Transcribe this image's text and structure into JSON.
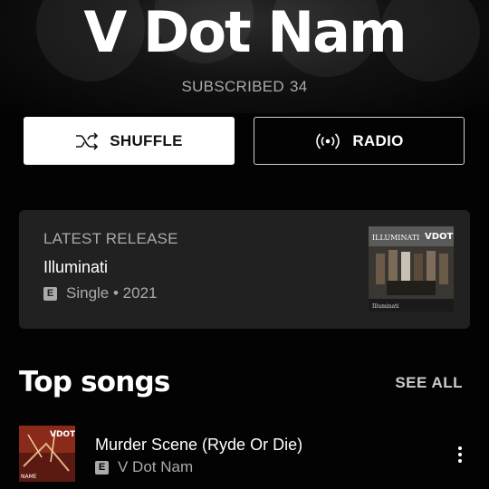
{
  "artist": {
    "name": "V Dot Nam",
    "subscribed_label": "SUBSCRIBED",
    "subscriber_count": "34"
  },
  "actions": {
    "shuffle_label": "SHUFFLE",
    "radio_label": "RADIO"
  },
  "latest_release": {
    "kicker": "LATEST RELEASE",
    "title": "Illuminati",
    "explicit_badge": "E",
    "meta": "Single • 2021",
    "art_text_left": "ILLUMINATI",
    "art_text_right": "VDOT",
    "art_text_bottom": "Illuminati"
  },
  "top_songs": {
    "heading": "Top songs",
    "see_all_label": "SEE ALL",
    "items": [
      {
        "title": "Murder Scene (Ryde Or Die)",
        "explicit_badge": "E",
        "artist": "V Dot Nam",
        "art_text_top": "VDOT",
        "art_text_bottom": "NAME"
      }
    ]
  },
  "colors": {
    "background": "#030303",
    "card": "#212121",
    "secondary_text": "#aaaaaa",
    "primary_text": "#ffffff"
  }
}
